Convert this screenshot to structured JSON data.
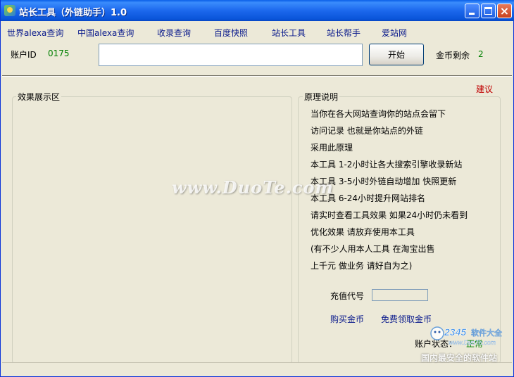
{
  "window": {
    "title": "站长工具（外链助手）1.0"
  },
  "menu": {
    "items": [
      "世界alexa查询",
      "中国alexa查询",
      "收录查询",
      "百度快照",
      "站长工具",
      "站长帮手",
      "爱站网"
    ]
  },
  "account": {
    "id_label": "账户ID",
    "id_value": "0175",
    "url_value": "",
    "start_label": "开始",
    "coins_label": "金币剩余",
    "coins_value": "2"
  },
  "suggest_label": "建议",
  "left_panel": {
    "title": "效果展示区"
  },
  "right_panel": {
    "title": "原理说明",
    "lines": [
      "当你在各大网站查询你的站点会留下",
      "访问记录 也就是你站点的外链",
      "采用此原理",
      "本工具 1-2小时让各大搜索引擎收录新站",
      "本工具 3-5小时外链自动增加 快照更新",
      "本工具 6-24小时提升网站排名",
      "请实时查看工具效果 如果24小时仍未看到",
      "优化效果 请放弃使用本工具",
      "(有不少人用本人工具 在淘宝出售",
      "上千元 做业务 请好自为之)"
    ],
    "recharge_label": "充值代号",
    "recharge_value": "",
    "buy_coins": "购买金币",
    "free_coins": "免费领取金币",
    "status_label": "账户状态：",
    "status_value": "正常"
  },
  "watermarks": {
    "duote": "www.DuoTe.com",
    "logo_number": "2345",
    "logo_suffix": "软件大全",
    "logo_url": "www.DuoTe.com",
    "logo_cn": "国内最安全的软件站"
  },
  "colors": {
    "titlebar": "#0a55d9",
    "link": "#0a1a8c",
    "green_value": "#008000",
    "suggest": "#c00000"
  }
}
